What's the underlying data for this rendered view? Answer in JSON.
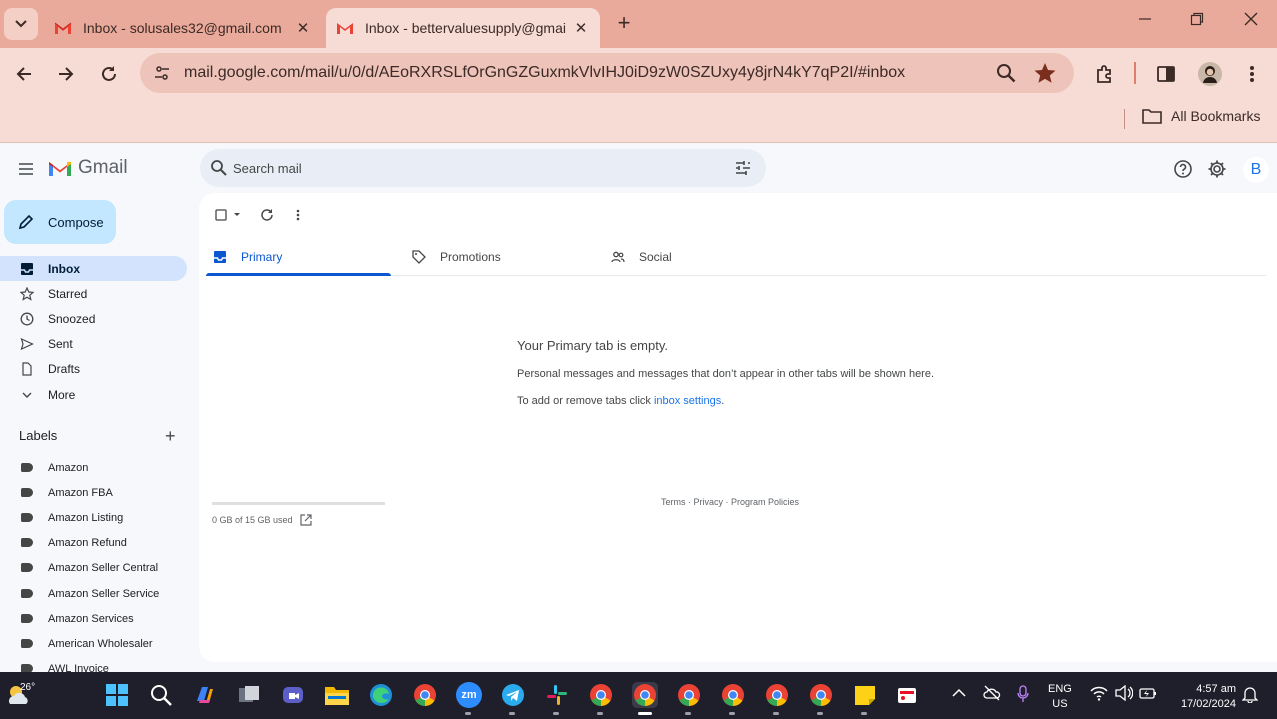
{
  "browser": {
    "tabs": [
      {
        "title": "Inbox - solusales32@gmail.com",
        "active": false
      },
      {
        "title": "Inbox - bettervaluesupply@gmail.com",
        "active": true
      }
    ],
    "url": "mail.google.com/mail/u/0/d/AEoRXRSLfOrGnGZGuxmkVlvIHJ0iD9zW0SZUxy4y8jrN4kY7qP2I/#inbox",
    "all_bookmarks": "All Bookmarks",
    "colors": {
      "frame": "#e9aa9b",
      "toolbar": "#f7dcd6",
      "omnibox": "#eec3b9"
    }
  },
  "gmail": {
    "logo_text": "Gmail",
    "search_placeholder": "Search mail",
    "avatar_initial": "B",
    "compose": "Compose",
    "nav": [
      "Inbox",
      "Starred",
      "Snoozed",
      "Sent",
      "Drafts",
      "More"
    ],
    "labels_header": "Labels",
    "labels": [
      "Amazon",
      "Amazon FBA",
      "Amazon Listing",
      "Amazon Refund",
      "Amazon Seller Central",
      "Amazon Seller Service",
      "Amazon Services",
      "American Wholesaler",
      "AWL Invoice"
    ],
    "tabs": [
      "Primary",
      "Promotions",
      "Social"
    ],
    "empty_title": "Your Primary tab is empty.",
    "empty_desc": "Personal messages and messages that don’t appear in other tabs will be shown here.",
    "settings_prefix": "To add or remove tabs click ",
    "settings_link": "inbox settings",
    "settings_suffix": ".",
    "storage_text": "0 GB of 15 GB used",
    "storage_fraction": 0,
    "footer": "Terms · Privacy · Program Policies",
    "colors": {
      "accent": "#0b57d0",
      "compose_bg": "#c2e7ff",
      "active_nav": "#d3e3fd"
    }
  },
  "taskbar": {
    "temperature": "26°",
    "apps": [
      "windows-start",
      "search",
      "copilot",
      "task-view",
      "teams",
      "file-explorer",
      "edge",
      "chrome",
      "zoom",
      "telegram",
      "slack",
      "chrome",
      "chrome",
      "chrome",
      "chrome",
      "chrome",
      "chrome",
      "sticky-notes",
      "snipping-tool"
    ],
    "zoom_label": "zm",
    "lang_top": "ENG",
    "lang_bottom": "US",
    "time": "4:57 am",
    "date": "17/02/2024"
  }
}
